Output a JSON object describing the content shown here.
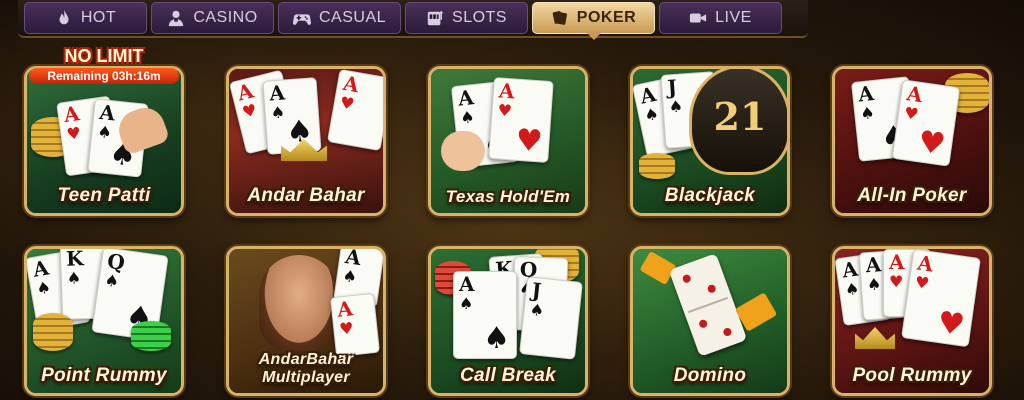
{
  "tabs": [
    {
      "label": "HOT",
      "icon": "flame-icon",
      "active": false
    },
    {
      "label": "CASINO",
      "icon": "dealer-icon",
      "active": false
    },
    {
      "label": "CASUAL",
      "icon": "gamepad-icon",
      "active": false
    },
    {
      "label": "SLOTS",
      "icon": "slot-machine-icon",
      "active": false
    },
    {
      "label": "POKER",
      "icon": "cards-icon",
      "active": true
    },
    {
      "label": "LIVE",
      "icon": "video-camera-icon",
      "active": false
    }
  ],
  "colors": {
    "tab_bg": "#3a2448",
    "tab_active": "#e4c080",
    "tile_border": "#d7b36a",
    "label_text": "#fff5dc"
  },
  "games": [
    {
      "id": "teen-patti",
      "label": "Teen Patti"
    },
    {
      "id": "andar-bahar",
      "label": "Andar Bahar"
    },
    {
      "id": "texas-holdem",
      "label": "Texas Hold'Em"
    },
    {
      "id": "blackjack",
      "label": "Blackjack"
    },
    {
      "id": "all-in-poker",
      "label": "All-In Poker"
    },
    {
      "id": "point-rummy",
      "label": "Point Rummy"
    },
    {
      "id": "andarbahar-multiplayer",
      "label_line1": "AndarBahar",
      "label_line2": "Multiplayer"
    },
    {
      "id": "call-break",
      "label": "Call Break"
    },
    {
      "id": "domino",
      "label": "Domino"
    },
    {
      "id": "pool-rummy",
      "label": "Pool Rummy"
    }
  ],
  "promo": {
    "title": "NO LIMIT",
    "timer": "Remaining 03h:16m"
  },
  "artwork": {
    "blackjack_number": "21",
    "card_ranks": {
      "A": "A",
      "K": "K",
      "Q": "Q",
      "J": "J"
    }
  }
}
